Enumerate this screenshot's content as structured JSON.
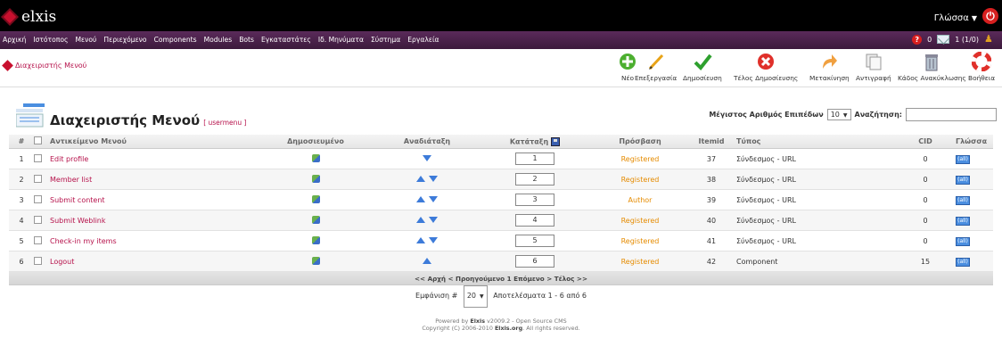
{
  "brand": {
    "name": "elxis"
  },
  "topbar": {
    "language_label": "Γλώσσα"
  },
  "menu": {
    "items": [
      "Αρχική",
      "Ιστότοπος",
      "Μενού",
      "Περιεχόμενο",
      "Components",
      "Modules",
      "Bots",
      "Εγκαταστάτες",
      "Ιδ. Μηνύματα",
      "Σύστημα",
      "Εργαλεία"
    ],
    "messages_count": "0",
    "users_online": "1 (1/0)"
  },
  "breadcrumb": "Διαχειριστής Μενού",
  "toolbar": [
    {
      "label": "Νέο",
      "icon": "new-icon"
    },
    {
      "label": "Επεξεργασία",
      "icon": "edit-icon"
    },
    {
      "label": "Δημοσίευση",
      "icon": "publish-icon"
    },
    {
      "label": "Τέλος Δημοσίευσης",
      "icon": "unpublish-icon"
    },
    {
      "label": "Μετακίνηση",
      "icon": "move-icon"
    },
    {
      "label": "Αντιγραφή",
      "icon": "copy-icon"
    },
    {
      "label": "Κάδος Ανακύκλωσης",
      "icon": "trash-icon"
    },
    {
      "label": "Βοήθεια",
      "icon": "help-icon"
    }
  ],
  "page": {
    "title": "Διαχειριστής Μενού",
    "subtitle": "[ usermenu ]"
  },
  "filters": {
    "max_levels_label": "Μέγιστος Αριθμός Επιπέδων",
    "max_levels_value": "10",
    "search_label": "Αναζήτηση:",
    "search_value": ""
  },
  "table": {
    "headers": {
      "num": "#",
      "item": "Αντικείμενο Μενού",
      "published": "Δημοσιευμένο",
      "reorder": "Αναδιάταξη",
      "order": "Κατάταξη",
      "access": "Πρόσβαση",
      "itemid": "Itemid",
      "type": "Τύπος",
      "cid": "CID",
      "language": "Γλώσσα"
    },
    "rows": [
      {
        "num": "1",
        "name": "Edit profile",
        "order": "1",
        "access": "Registered",
        "itemid": "37",
        "type": "Σύνδεσμος - URL",
        "cid": "0",
        "up": false,
        "down": true
      },
      {
        "num": "2",
        "name": "Member list",
        "order": "2",
        "access": "Registered",
        "itemid": "38",
        "type": "Σύνδεσμος - URL",
        "cid": "0",
        "up": true,
        "down": true
      },
      {
        "num": "3",
        "name": "Submit content",
        "order": "3",
        "access": "Author",
        "itemid": "39",
        "type": "Σύνδεσμος - URL",
        "cid": "0",
        "up": true,
        "down": true
      },
      {
        "num": "4",
        "name": "Submit Weblink",
        "order": "4",
        "access": "Registered",
        "itemid": "40",
        "type": "Σύνδεσμος - URL",
        "cid": "0",
        "up": true,
        "down": true
      },
      {
        "num": "5",
        "name": "Check-in my items",
        "order": "5",
        "access": "Registered",
        "itemid": "41",
        "type": "Σύνδεσμος - URL",
        "cid": "0",
        "up": true,
        "down": true
      },
      {
        "num": "6",
        "name": "Logout",
        "order": "6",
        "access": "Registered",
        "itemid": "42",
        "type": "Component",
        "cid": "15",
        "up": true,
        "down": false
      }
    ],
    "language_badge": "(all)"
  },
  "pagination": {
    "links": "<< Αρχή < Προηγούμενο 1 Επόμενο > Τέλος >>",
    "display_label": "Εμφάνιση #",
    "display_value": "20",
    "results": "Αποτελέσματα 1 - 6 από 6"
  },
  "footer": {
    "line1_prefix": "Powered by",
    "line1_brand": "Elxis",
    "line1_suffix": "v2009.2 - Open Source CMS",
    "line2_prefix": "Copyright (C) 2006-2010",
    "line2_brand": "Elxis.org",
    "line2_suffix": ". All rights reserved."
  }
}
